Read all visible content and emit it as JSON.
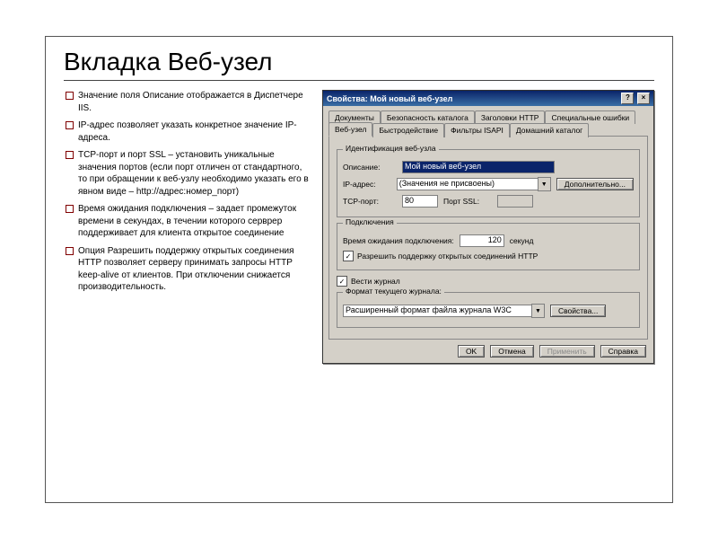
{
  "slide": {
    "title": "Вкладка Веб-узел",
    "bullets": [
      "Значение поля Описание отображается в Диспетчере IIS.",
      "IP-адрес позволяет указать конкретное значение IP-адреса.",
      "TCP-порт и порт SSL – установить уникальные значения портов (если порт отличен от стандартного, то при обращении к веб-узлу необходимо указать его в явном виде – http://адрес:номер_порт)",
      "Время ожидания подключения – задает промежуток времени в секундах, в течении которого серврер поддерживает для клиента открытое соединение",
      "Опция Разрешить поддержку открытых соединения HTTP позволяет серверу принимать запросы HTTP keep-alive от клиентов. При отключении снижается производительность."
    ]
  },
  "dialog": {
    "title": "Свойства: Мой новый веб-узел",
    "close_x": "×",
    "help_q": "?",
    "tabs_row1": [
      "Документы",
      "Безопасность каталога",
      "Заголовки HTTP",
      "Специальные ошибки"
    ],
    "tabs_row2": [
      "Веб-узел",
      "Быстродействие",
      "Фильтры ISAPI",
      "Домашний каталог"
    ],
    "active_tab": "Веб-узел",
    "group_ident": {
      "legend": "Идентификация веб-узла",
      "desc_label": "Описание:",
      "desc_value": "Мой новый веб-узел",
      "ip_label": "IP-адрес:",
      "ip_value": "(Значения не присвоены)",
      "advanced_btn": "Дополнительно...",
      "tcp_label": "TCP-порт:",
      "tcp_value": "80",
      "ssl_label": "Порт SSL:",
      "ssl_value": ""
    },
    "group_conn": {
      "legend": "Подключения",
      "timeout_label": "Время ожидания подключения:",
      "timeout_value": "120",
      "timeout_unit": "секунд",
      "keepalive_label": "Разрешить поддержку открытых соединений HTTP",
      "keepalive_checked": true
    },
    "group_log": {
      "enable_label": "Вести журнал",
      "enable_checked": true,
      "format_legend": "Формат текущего журнала:",
      "format_value": "Расширенный формат файла журнала W3C",
      "props_btn": "Свойства..."
    },
    "footer": {
      "ok": "OK",
      "cancel": "Отмена",
      "apply": "Применить",
      "help": "Справка"
    }
  }
}
